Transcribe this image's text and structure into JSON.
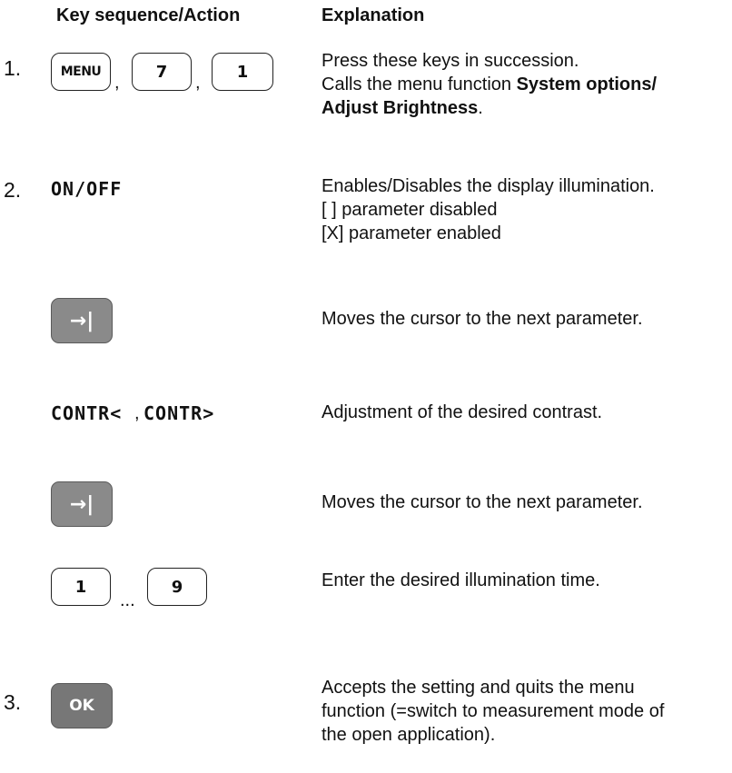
{
  "headers": {
    "left": "Key sequence/Action",
    "right": "Explanation"
  },
  "steps": [
    {
      "number": "1.",
      "keys": [
        "MENU",
        "7",
        "1"
      ],
      "separators": [
        ",",
        ","
      ],
      "explanation_lines": [
        "Press these keys in succession.",
        "Calls the menu function ",
        "System options/",
        "Adjust Brightness",
        "."
      ]
    },
    {
      "number": "2.",
      "softkey": "ON/OFF",
      "explanation_lines": [
        "Enables/Disables the display illumination.",
        "[  ] parameter disabled",
        "[X] parameter enabled"
      ]
    },
    {
      "key": "→|",
      "explanation": "Moves the cursor to the next parameter."
    },
    {
      "softkeys": [
        "CONTR<",
        "CONTR>"
      ],
      "separator": ",",
      "explanation": "Adjustment of the desired contrast."
    },
    {
      "key": "→|",
      "explanation": "Moves the cursor to the next parameter."
    },
    {
      "keys": [
        "1",
        "9"
      ],
      "separator": "...",
      "explanation": "Enter the desired illumination time."
    },
    {
      "number": "3.",
      "key": "OK",
      "explanation_lines": [
        "Accepts the setting and quits the menu",
        "function (=switch to measurement mode of",
        "the open application)."
      ]
    }
  ]
}
